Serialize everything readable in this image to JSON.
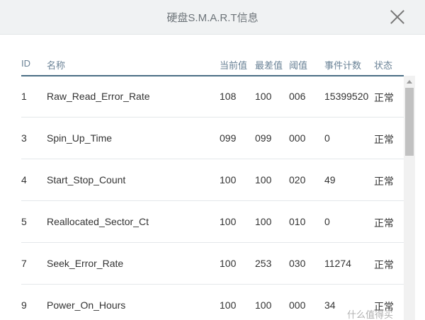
{
  "dialog": {
    "title": "硬盘S.M.A.R.T信息",
    "close_icon": "close-icon"
  },
  "table": {
    "headers": {
      "id": "ID",
      "name": "名称",
      "current": "当前值",
      "worst": "最差值",
      "threshold": "阈值",
      "events": "事件计数",
      "status": "状态"
    },
    "rows": [
      {
        "id": "1",
        "name": "Raw_Read_Error_Rate",
        "current": "108",
        "worst": "100",
        "threshold": "006",
        "events": "15399520",
        "status": "正常"
      },
      {
        "id": "3",
        "name": "Spin_Up_Time",
        "current": "099",
        "worst": "099",
        "threshold": "000",
        "events": "0",
        "status": "正常"
      },
      {
        "id": "4",
        "name": "Start_Stop_Count",
        "current": "100",
        "worst": "100",
        "threshold": "020",
        "events": "49",
        "status": "正常"
      },
      {
        "id": "5",
        "name": "Reallocated_Sector_Ct",
        "current": "100",
        "worst": "100",
        "threshold": "010",
        "events": "0",
        "status": "正常"
      },
      {
        "id": "7",
        "name": "Seek_Error_Rate",
        "current": "100",
        "worst": "253",
        "threshold": "030",
        "events": "11274",
        "status": "正常"
      },
      {
        "id": "9",
        "name": "Power_On_Hours",
        "current": "100",
        "worst": "100",
        "threshold": "000",
        "events": "34",
        "status": "正常"
      }
    ]
  },
  "watermark": "什么值得买",
  "colors": {
    "header_text": "#6a8296",
    "header_rule": "#4a6d84",
    "title_bar": "#f0f2f3"
  }
}
